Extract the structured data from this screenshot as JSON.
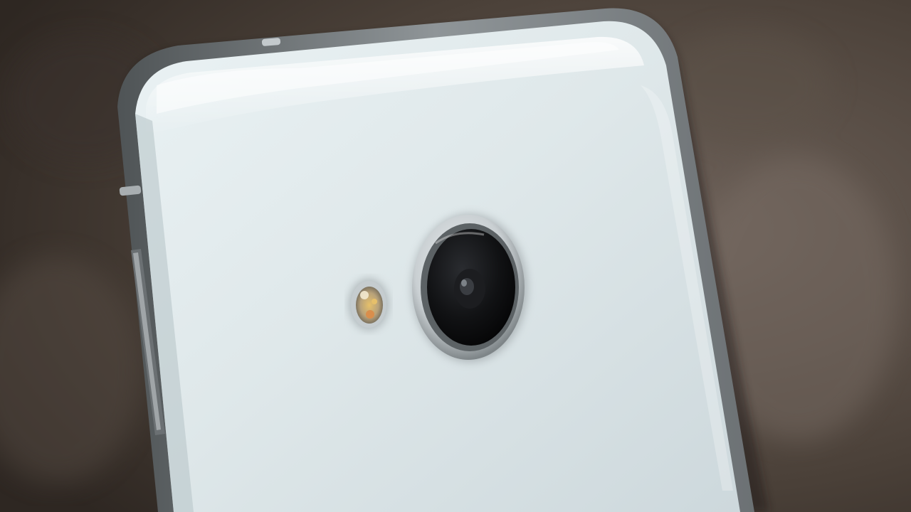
{
  "scene": {
    "subject": "smartphone-back",
    "colors": {
      "background": "#4a4038",
      "background_light": "#6e625a",
      "background_dark": "#2e2722",
      "phone_body": "#dfe8ea",
      "phone_body_light": "#f2f8f9",
      "phone_body_shadow": "#b9c6ca",
      "frame": "#8f9598",
      "frame_dark": "#4f5456",
      "camera_ring": "#c9cfd2",
      "lens_glass": "#0d0e10",
      "flash_yellow": "#e6c06a",
      "flash_orange": "#d98e4c"
    },
    "elements": [
      "phone-body",
      "camera-lens",
      "camera-ring",
      "flash-led",
      "side-button",
      "glossy-highlight"
    ]
  }
}
